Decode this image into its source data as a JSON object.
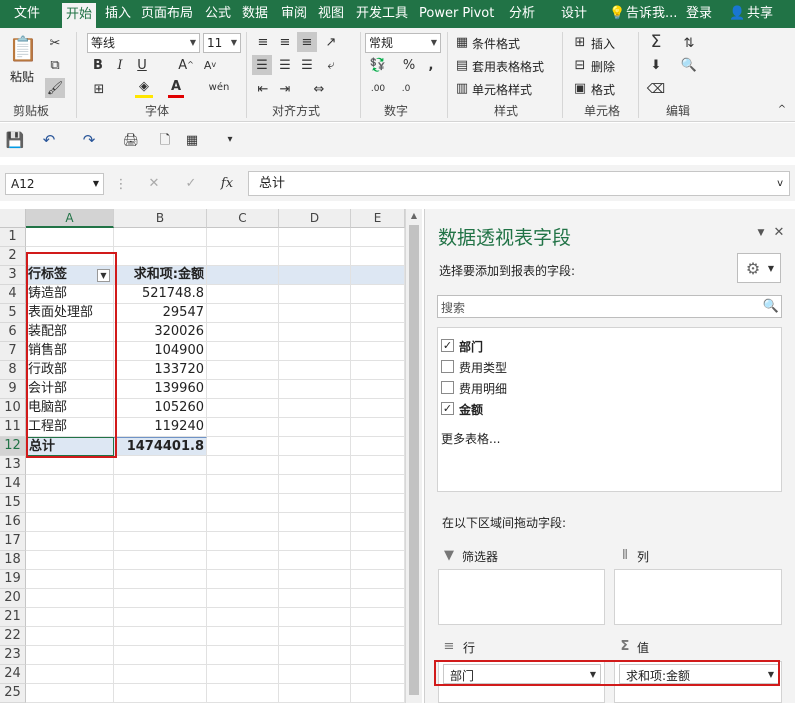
{
  "ribbon_tabs": [
    "文件",
    "开始",
    "插入",
    "页面布局",
    "公式",
    "数据",
    "审阅",
    "视图",
    "开发工具",
    "Power Pivot",
    "分析",
    "设计"
  ],
  "tell_me": "告诉我...",
  "login": "登录",
  "share": "共享",
  "clipboard": {
    "paste": "粘贴",
    "label": "剪贴板"
  },
  "font": {
    "name": "等线",
    "size": "11",
    "label": "字体"
  },
  "alignment": {
    "label": "对齐方式"
  },
  "number": {
    "format": "常规",
    "label": "数字"
  },
  "styles": {
    "conditional": "条件格式",
    "table": "套用表格格式",
    "cell": "单元格样式",
    "label": "样式"
  },
  "cells": {
    "insert": "插入",
    "delete": "删除",
    "format": "格式",
    "label": "单元格"
  },
  "editing": {
    "label": "编辑"
  },
  "formula_bar": {
    "name_box": "A12",
    "fx": "fx",
    "content": "总计"
  },
  "sheet": {
    "columns": [
      "A",
      "B",
      "C",
      "D",
      "E"
    ],
    "rows": [
      "1",
      "2",
      "3",
      "4",
      "5",
      "6",
      "7",
      "8",
      "9",
      "10",
      "11",
      "12",
      "13",
      "14",
      "15",
      "16",
      "17",
      "18",
      "19",
      "20",
      "21",
      "22",
      "23",
      "24",
      "25"
    ],
    "pivot_header": {
      "row_label": "行标签",
      "value_label": "求和项:金额"
    },
    "pivot_rows": [
      {
        "label": "铸造部",
        "value": "521748.8"
      },
      {
        "label": "表面处理部",
        "value": "29547"
      },
      {
        "label": "装配部",
        "value": "320026"
      },
      {
        "label": "销售部",
        "value": "104900"
      },
      {
        "label": "行政部",
        "value": "133720"
      },
      {
        "label": "会计部",
        "value": "139960"
      },
      {
        "label": "电脑部",
        "value": "105260"
      },
      {
        "label": "工程部",
        "value": "119240"
      }
    ],
    "total": {
      "label": "总计",
      "value": "1474401.8"
    }
  },
  "pivot_pane": {
    "title": "数据透视表字段",
    "subtitle": "选择要添加到报表的字段:",
    "search_placeholder": "搜索",
    "fields": [
      {
        "name": "部门",
        "checked": true
      },
      {
        "name": "费用类型",
        "checked": false
      },
      {
        "name": "费用明细",
        "checked": false
      },
      {
        "name": "金额",
        "checked": true
      }
    ],
    "more_tables": "更多表格...",
    "drag_hint": "在以下区域间拖动字段:",
    "areas": {
      "filters": "筛选器",
      "columns": "列",
      "rows": "行",
      "values": "值"
    },
    "row_field": "部门",
    "value_field": "求和项:金额"
  },
  "colors": {
    "accent": "#217346",
    "highlight": "#d11a1a",
    "pivot_header": "#dde7f3"
  }
}
